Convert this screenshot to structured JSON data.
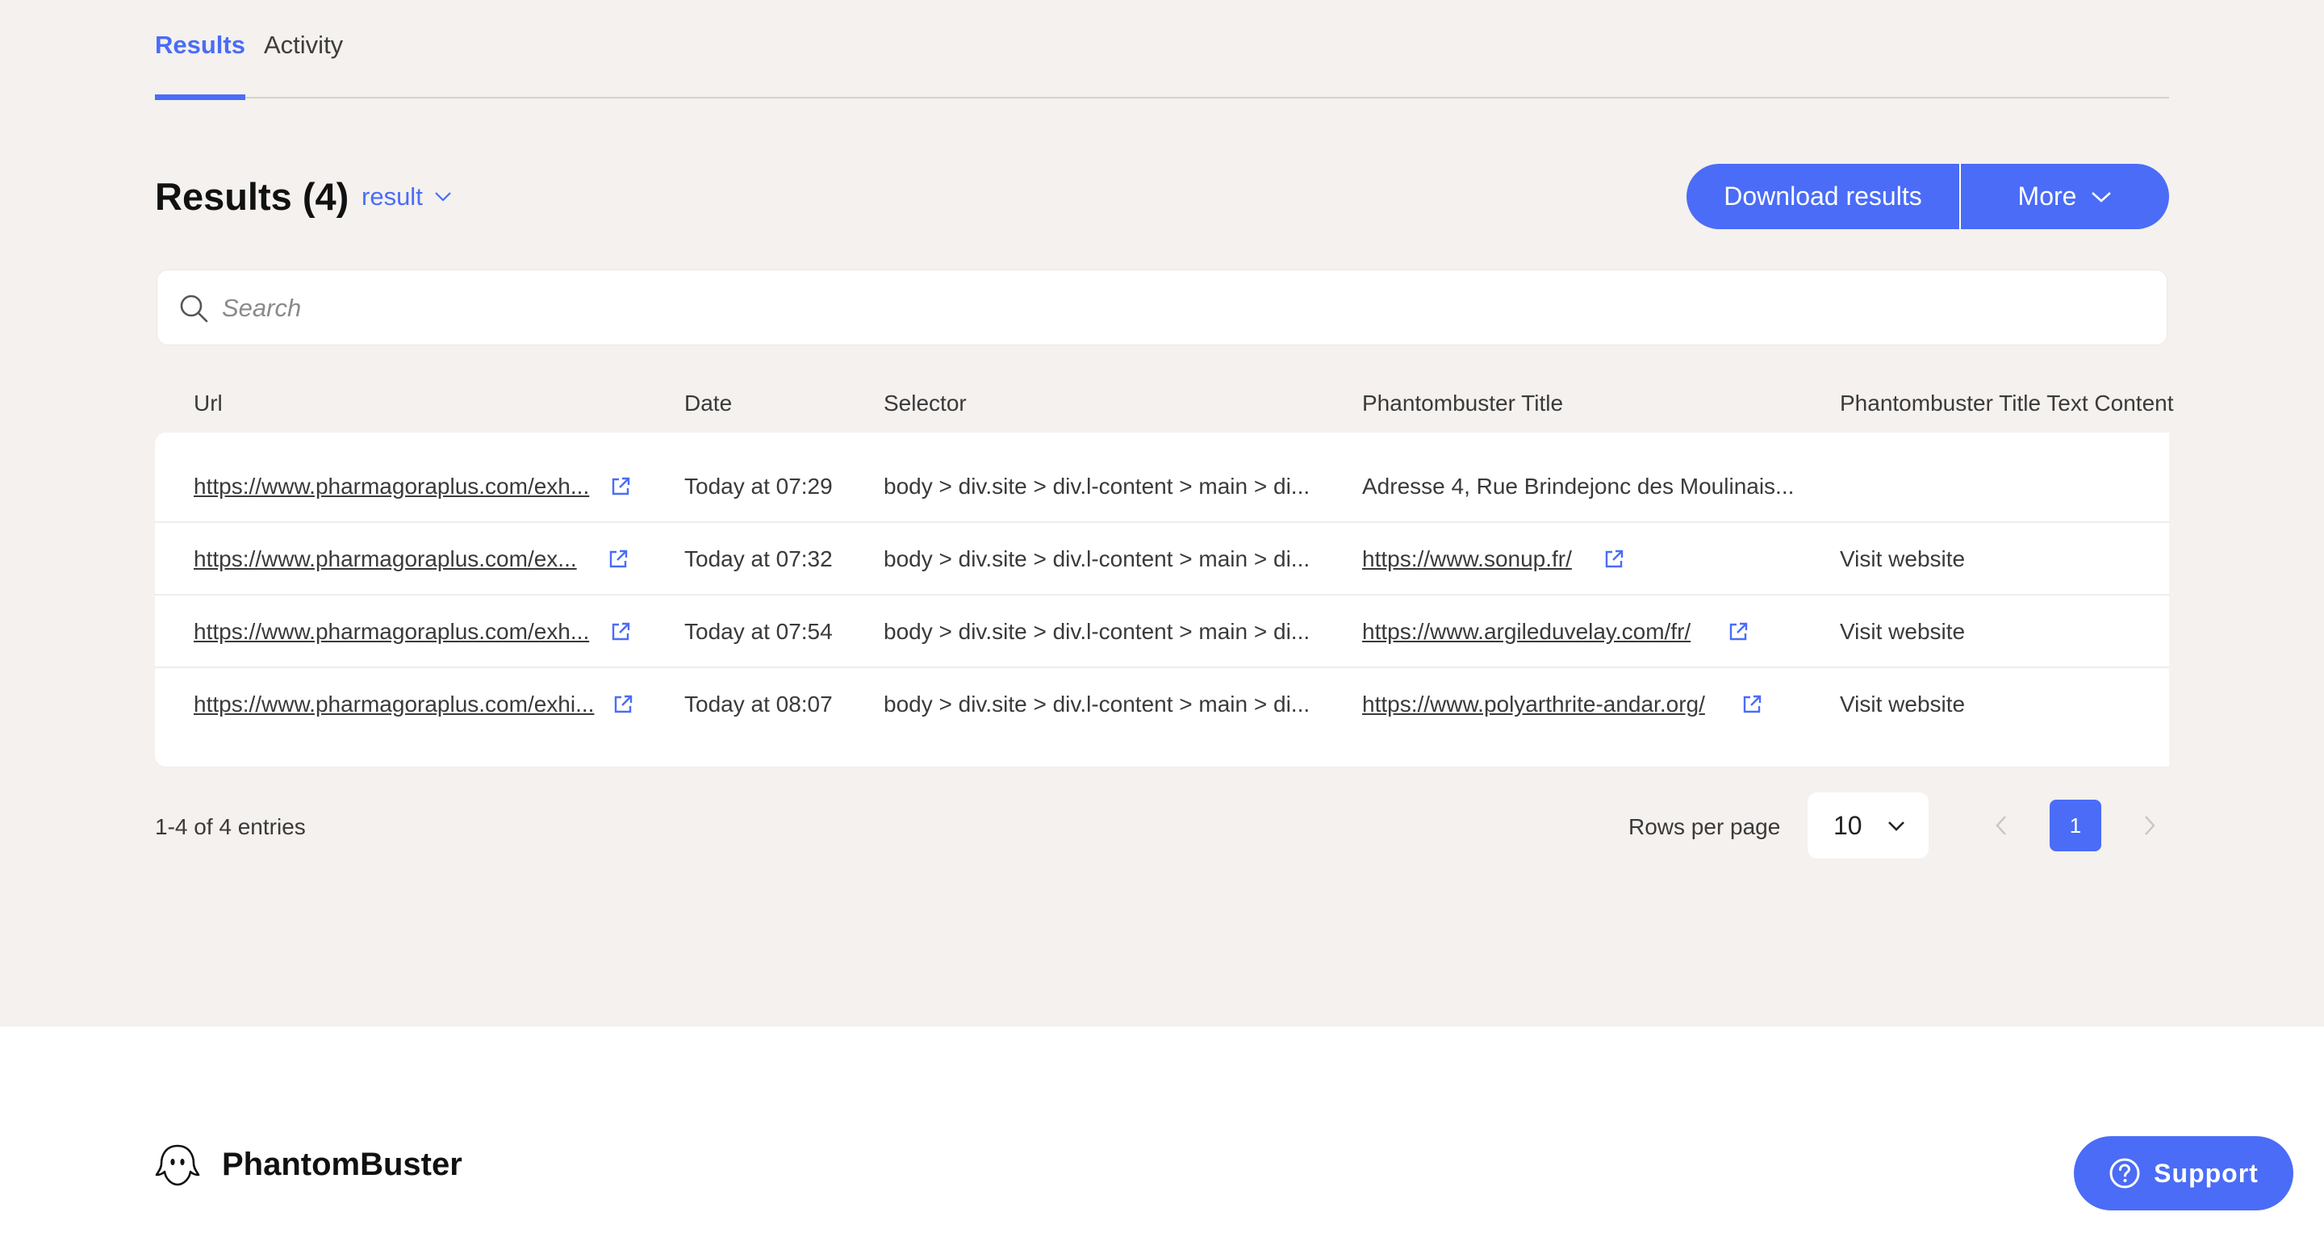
{
  "tabs": [
    {
      "label": "Results",
      "active": true
    },
    {
      "label": "Activity",
      "active": false
    }
  ],
  "header": {
    "title": "Results (4)",
    "result_selector": "result",
    "download_label": "Download results",
    "more_label": "More"
  },
  "search": {
    "placeholder": "Search",
    "value": ""
  },
  "table": {
    "columns": [
      "Url",
      "Date",
      "Selector",
      "Phantombuster Title",
      "Phantombuster Title Text Content"
    ],
    "rows": [
      {
        "url": "https://www.pharmagoraplus.com/exh...",
        "date": "Today at 07:29",
        "selector": "body > div.site > div.l-content > main > di...",
        "title": "Adresse 4, Rue Brindejonc des Moulinais...",
        "title_is_link": false,
        "text_content": ""
      },
      {
        "url": "https://www.pharmagoraplus.com/ex...",
        "date": "Today at 07:32",
        "selector": "body > div.site > div.l-content > main > di...",
        "title": "https://www.sonup.fr/",
        "title_is_link": true,
        "text_content": "Visit website"
      },
      {
        "url": "https://www.pharmagoraplus.com/exh...",
        "date": "Today at 07:54",
        "selector": "body > div.site > div.l-content > main > di...",
        "title": "https://www.argileduvelay.com/fr/",
        "title_is_link": true,
        "text_content": "Visit website"
      },
      {
        "url": "https://www.pharmagoraplus.com/exhi...",
        "date": "Today at 08:07",
        "selector": "body > div.site > div.l-content > main > di...",
        "title": "https://www.polyarthrite-andar.org/",
        "title_is_link": true,
        "text_content": "Visit website"
      }
    ]
  },
  "pagination": {
    "entries_text": "1-4 of 4 entries",
    "rows_per_page_label": "Rows per page",
    "rows_per_page_value": "10",
    "current_page": "1"
  },
  "footer": {
    "brand": "PhantomBuster",
    "support_label": "Support"
  },
  "colors": {
    "accent": "#4a6cf7",
    "background": "#f4f1ee"
  }
}
